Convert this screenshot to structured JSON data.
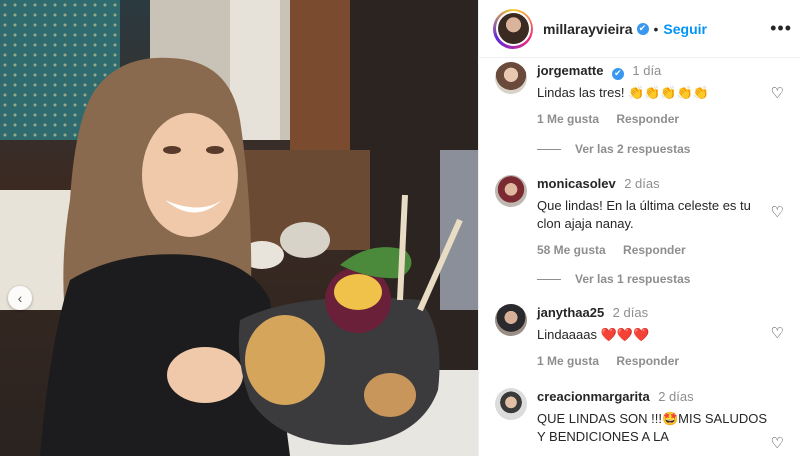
{
  "header": {
    "username": "millarayvieira",
    "verified_badge": "✔",
    "separator": "•",
    "follow_label": "Seguir",
    "more_icon": "•••"
  },
  "photo": {
    "prev_icon": "‹"
  },
  "comments": [
    {
      "user": "jorgematte",
      "verified": true,
      "time": "1 día",
      "text": "Lindas las tres! 👏👏👏👏👏",
      "likes": "1 Me gusta",
      "reply": "Responder",
      "view_replies": "Ver las 2 respuestas"
    },
    {
      "user": "monicasolev",
      "verified": false,
      "time": "2 días",
      "text": "Que lindas! En la última celeste es tu clon ajaja nanay.",
      "likes": "58 Me gusta",
      "reply": "Responder",
      "view_replies": "Ver las 1 respuestas"
    },
    {
      "user": "janythaa25",
      "verified": false,
      "time": "2 días",
      "text": "Lindaaaas ❤️❤️❤️",
      "likes": "1 Me gusta",
      "reply": "Responder"
    },
    {
      "user": "creacionmargarita",
      "verified": false,
      "time": "2 días",
      "text": "QUE LINDAS SON !!!🤩MIS SALUDOS Y BENDICIONES A LA"
    }
  ],
  "heart_icon": "♡"
}
